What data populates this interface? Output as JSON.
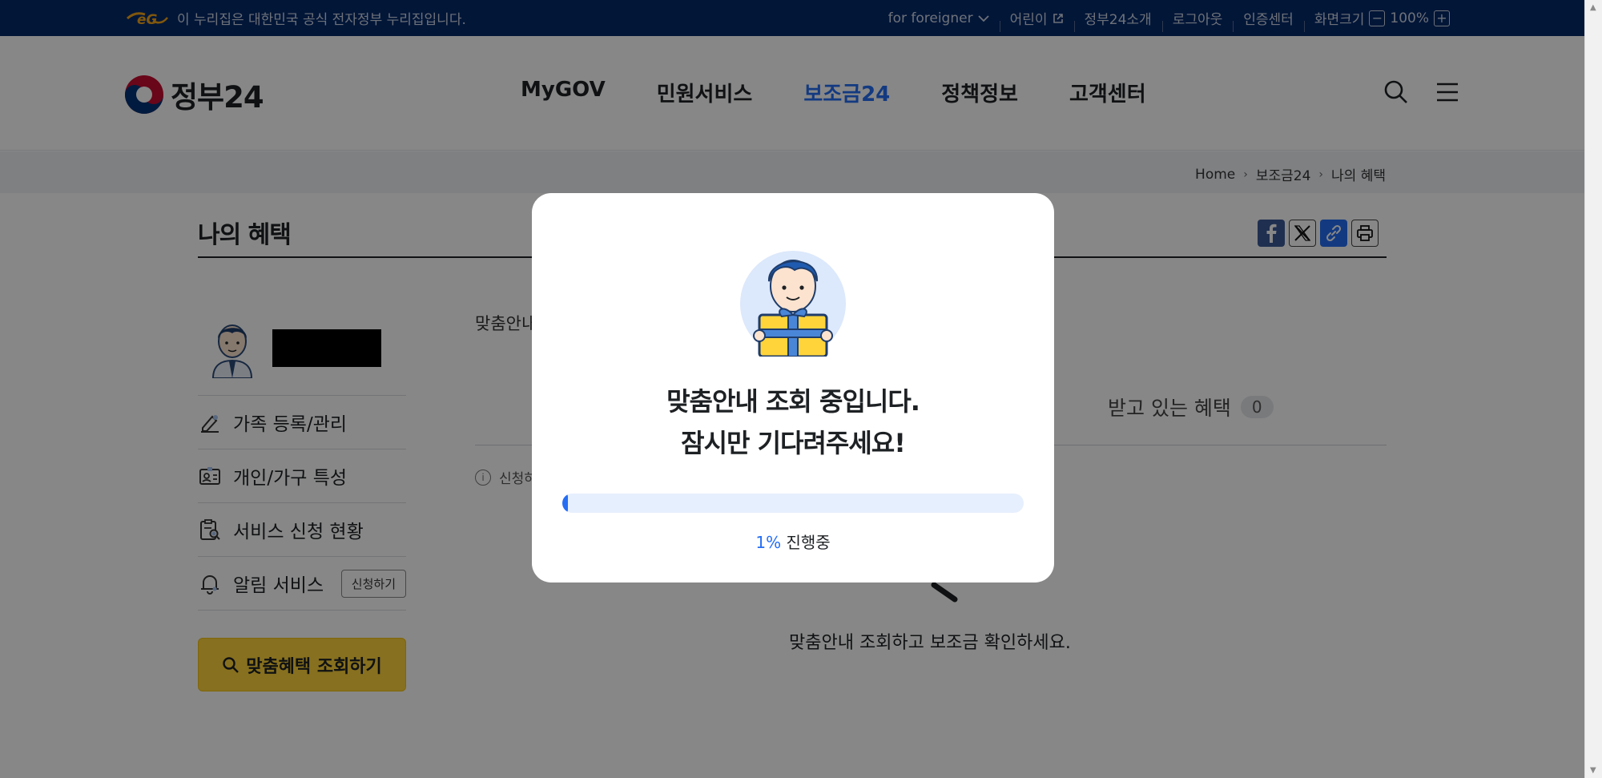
{
  "gov_banner": {
    "text": "이 누리집은 대한민국 공식 전자정부 누리집입니다.",
    "foreigner": "for foreigner",
    "children": "어린이",
    "about": "정부24소개",
    "logout": "로그아웃",
    "cert_center": "인증센터",
    "screen_size": "화면크기",
    "zoom_minus": "−",
    "zoom_value": "100%",
    "zoom_plus": "+"
  },
  "header": {
    "logo_text": "정부24",
    "nav": [
      "MyGOV",
      "민원서비스",
      "보조금24",
      "정책정보",
      "고객센터"
    ],
    "active_nav": "보조금24"
  },
  "breadcrumb": [
    "Home",
    "보조금24",
    "나의 혜택"
  ],
  "page_title": "나의 혜택",
  "sidebar": {
    "menu": [
      {
        "label": "가족 등록/관리",
        "icon": "edit-icon"
      },
      {
        "label": "개인/가구 특성",
        "icon": "id-card-icon"
      },
      {
        "label": "서비스 신청 현황",
        "icon": "clipboard-search-icon"
      },
      {
        "label": "알림 서비스",
        "icon": "bell-icon",
        "button": "신청하기"
      }
    ],
    "search_button": "맞춤혜택 조회하기"
  },
  "content": {
    "intro_partial": "맞춤안내",
    "tab_received": "받고 있는 혜택",
    "tab_received_count": "0",
    "notice_partial": "신청하",
    "empty_message": "맞춤안내 조회하고 보조금 확인하세요."
  },
  "modal": {
    "line1": "맞춤안내 조회 중입니다.",
    "line2": "잠시만 기다려주세요!",
    "progress_percent": 1,
    "progress_label": "1%",
    "progress_suffix": "진행중"
  },
  "colors": {
    "brand_navy": "#052b6b",
    "accent_blue": "#256ef4",
    "cta_yellow": "#ffd43b"
  }
}
